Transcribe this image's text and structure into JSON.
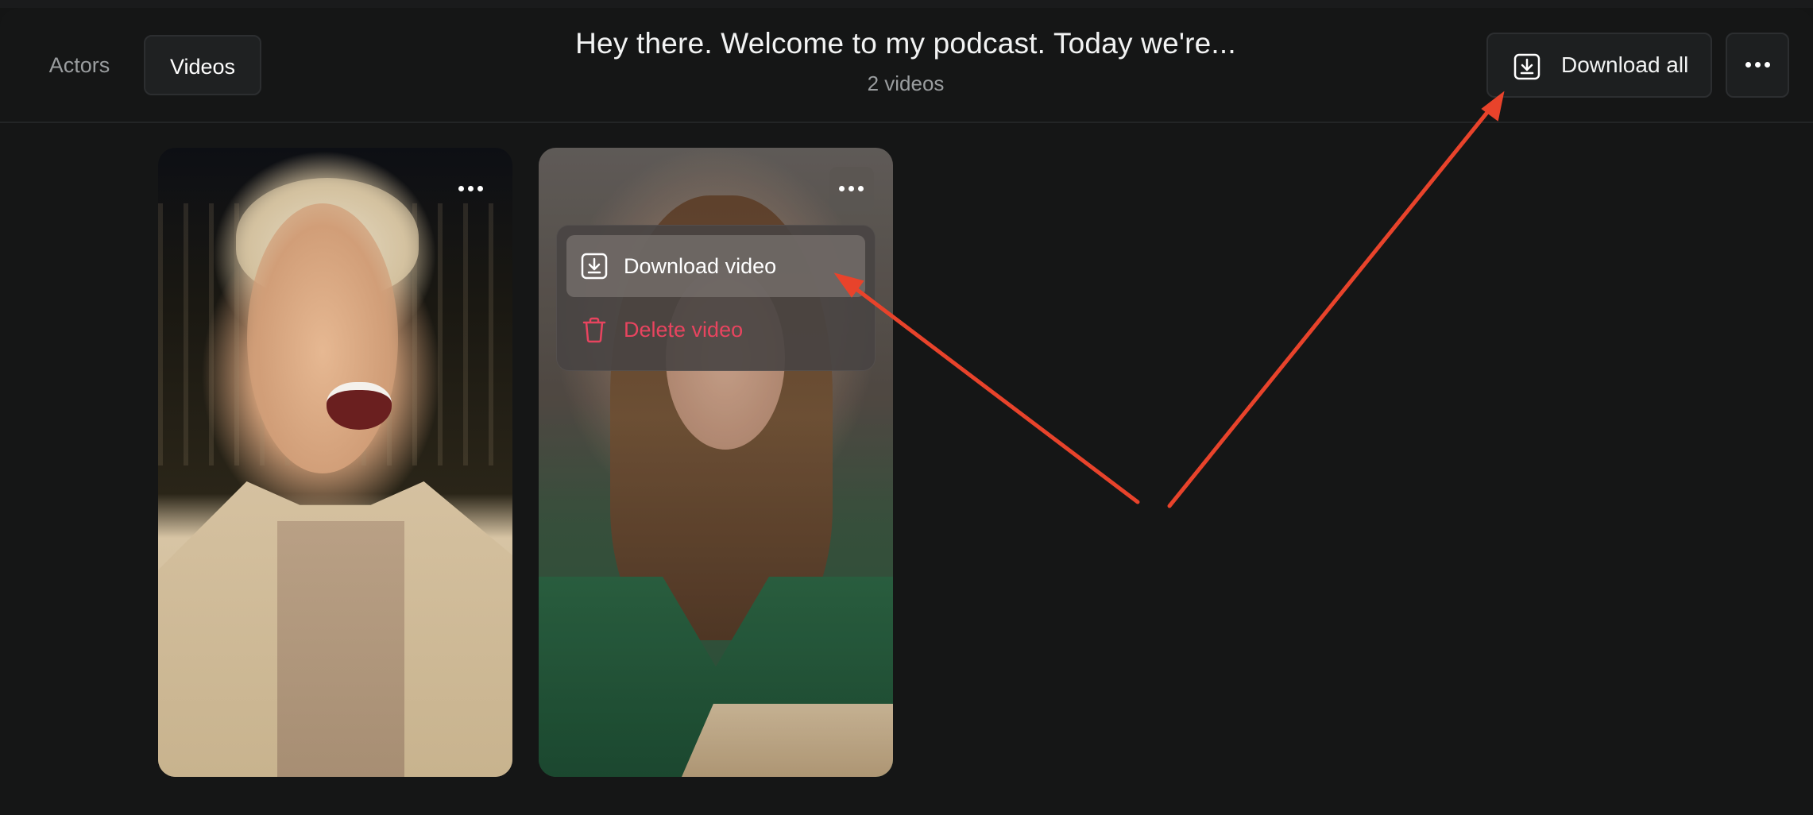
{
  "header": {
    "tabs": [
      {
        "label": "Actors",
        "active": false
      },
      {
        "label": "Videos",
        "active": true
      }
    ],
    "title": "Hey there. Welcome to my podcast. Today we're...",
    "subtitle": "2 videos",
    "download_all_label": "Download all",
    "more_icon": "more-horizontal-icon"
  },
  "videos": [
    {
      "id": "video-1",
      "menu_open": false
    },
    {
      "id": "video-2",
      "menu_open": true
    }
  ],
  "context_menu": {
    "items": [
      {
        "label": "Download video",
        "icon": "download-icon"
      },
      {
        "label": "Delete video",
        "icon": "trash-icon",
        "color": "#e8445f"
      }
    ]
  },
  "colors": {
    "background": "#151616",
    "annotation_arrow": "#e8432b",
    "danger": "#e8445f"
  }
}
